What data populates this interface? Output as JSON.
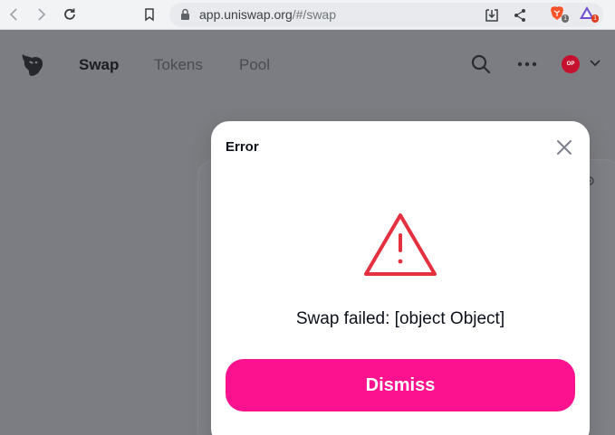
{
  "browser": {
    "url_host": "app.uniswap.org",
    "url_path": "/#/swap",
    "brave_badge": "1",
    "rewards_badge": "1"
  },
  "header": {
    "nav": [
      {
        "label": "Swap",
        "active": true
      },
      {
        "label": "Tokens",
        "active": false
      },
      {
        "label": "Pool",
        "active": false
      }
    ],
    "network_badge": "OP"
  },
  "modal": {
    "title": "Error",
    "message": "Swap failed: [object Object]",
    "dismiss_label": "Dismiss",
    "icon": "warning-triangle-icon",
    "accent": "#fc118f",
    "danger": "#e5303f"
  }
}
